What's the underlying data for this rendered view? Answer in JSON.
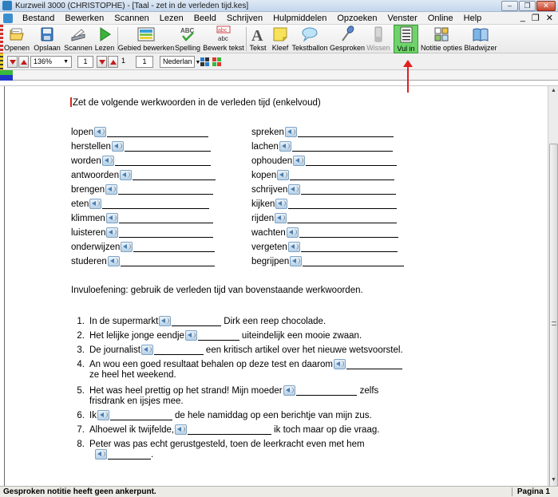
{
  "window": {
    "title": "Kurzweil 3000 (CHRISTOPHE) - [Taal - zet in de verleden tijd.kes]",
    "minimize": "–",
    "restore": "❐",
    "close": "✕"
  },
  "menu": {
    "items": [
      "Bestand",
      "Bewerken",
      "Scannen",
      "Lezen",
      "Beeld",
      "Schrijven",
      "Hulpmiddelen",
      "Opzoeken",
      "Venster",
      "Online",
      "Help"
    ],
    "mdi": [
      "_",
      "❐",
      "✕"
    ]
  },
  "toolbar": {
    "buttons": [
      {
        "label": "Openen",
        "icon": "open-folder-icon"
      },
      {
        "label": "Opslaan",
        "icon": "save-icon"
      },
      {
        "label": "Scannen",
        "icon": "scanner-icon"
      },
      {
        "label": "Lezen",
        "icon": "play-icon"
      },
      {
        "label": "Gebied bewerken",
        "icon": "edit-area-icon"
      },
      {
        "label": "Spelling",
        "icon": "spelling-icon"
      },
      {
        "label": "Bewerk tekst",
        "icon": "edit-text-icon"
      },
      {
        "label": "Tekst",
        "icon": "text-icon"
      },
      {
        "label": "Kleef",
        "icon": "sticky-note-icon"
      },
      {
        "label": "Tekstballon",
        "icon": "speech-balloon-icon"
      },
      {
        "label": "Gesproken",
        "icon": "microphone-icon"
      },
      {
        "label": "Wissen",
        "icon": "eraser-icon"
      },
      {
        "label": "Vul in",
        "icon": "fill-in-icon"
      },
      {
        "label": "Notitie opties",
        "icon": "note-options-icon"
      },
      {
        "label": "Bladwijzer",
        "icon": "bookmark-icon"
      }
    ],
    "spelling_glyph": "ABC",
    "edit_glyph_top": "abc",
    "edit_glyph_bottom": "abc",
    "text_glyph": "A"
  },
  "toolbar2": {
    "zoom": "136%",
    "page_field": "1",
    "page_field2": "1",
    "voice_field": "1",
    "language": "Nederlan"
  },
  "colors": {
    "active_button": "#6ed46a",
    "annotation_arrow": "#e02020",
    "cursor": "#e2261c"
  },
  "doc": {
    "heading": "Zet de volgende werkwoorden in de verleden tijd (enkelvoud)",
    "left_verbs": [
      "lopen",
      "herstellen",
      "worden",
      "antwoorden",
      "brengen",
      "eten",
      "klimmen",
      "luisteren",
      "onderwijzen",
      "studeren"
    ],
    "right_verbs": [
      "spreken",
      "lachen",
      "ophouden",
      "kopen",
      "schrijven",
      "kijken",
      "rijden",
      "wachten",
      "vergeten",
      "begrijpen"
    ],
    "exercise_intro": "Invuloefening: gebruik de verleden tijd van bovenstaande werkwoorden.",
    "sentences": [
      {
        "n": "1.",
        "a": "In de supermarkt",
        "b": "Dirk een reep chocolade.",
        "c": ""
      },
      {
        "n": "2.",
        "a": "Het lelijke jonge eendje",
        "b": "uiteindelijk een mooie zwaan.",
        "c": ""
      },
      {
        "n": "3.",
        "a": "De journalist",
        "b": "een kritisch artikel over het nieuwe wetsvoorstel.",
        "c": ""
      },
      {
        "n": "4.",
        "a": "An wou een goed resultaat behalen op deze test en daarom",
        "b": "",
        "c": "ze heel het weekend."
      },
      {
        "n": "5.",
        "a": "Het was heel prettig op het strand! Mijn moeder",
        "b": "zelfs",
        "c": "frisdrank en ijsjes mee."
      },
      {
        "n": "6.",
        "a": "Ik",
        "b": "de hele namiddag op een berichtje van mijn zus.",
        "c": ""
      },
      {
        "n": "7.",
        "a": "Alhoewel ik twijfelde,",
        "b": "ik toch maar op die vraag.",
        "c": ""
      },
      {
        "n": "8.",
        "a": "Peter was pas echt gerustgesteld, toen de leerkracht even met hem",
        "b": "",
        "c": "."
      }
    ]
  },
  "status": {
    "left": "Gesproken notitie heeft geen ankerpunt.",
    "right": "Pagina 1"
  }
}
